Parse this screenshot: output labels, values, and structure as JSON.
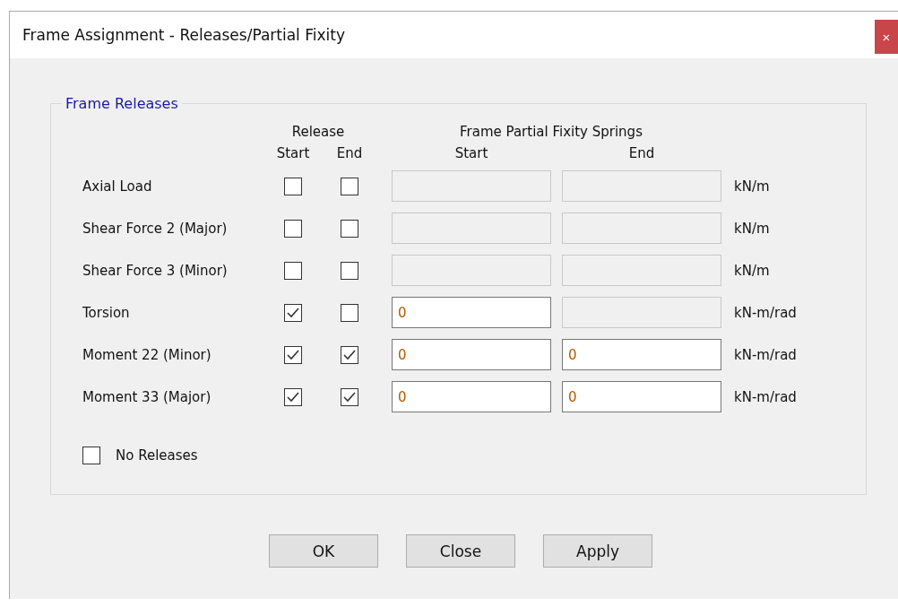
{
  "window": {
    "title": "Frame Assignment - Releases/Partial Fixity",
    "close": "×"
  },
  "group": {
    "title": "Frame Releases",
    "headers": {
      "release": "Release",
      "springs": "Frame Partial Fixity Springs",
      "release_start": "Start",
      "release_end": "End",
      "springs_start": "Start",
      "springs_end": "End"
    },
    "rows": [
      {
        "label": "Axial Load",
        "start_checked": false,
        "end_checked": false,
        "start_field": {
          "disabled": true
        },
        "end_field": {
          "disabled": true
        },
        "unit": "kN/m"
      },
      {
        "label": "Shear Force 2 (Major)",
        "start_checked": false,
        "end_checked": false,
        "start_field": {
          "disabled": true
        },
        "end_field": {
          "disabled": true
        },
        "unit": "kN/m"
      },
      {
        "label": "Shear Force 3 (Minor)",
        "start_checked": false,
        "end_checked": false,
        "start_field": {
          "disabled": true
        },
        "end_field": {
          "disabled": true
        },
        "unit": "kN/m"
      },
      {
        "label": "Torsion",
        "start_checked": true,
        "end_checked": false,
        "start_field": {
          "disabled": false,
          "value": "0"
        },
        "end_field": {
          "disabled": true
        },
        "unit": "kN-m/rad"
      },
      {
        "label": "Moment 22 (Minor)",
        "start_checked": true,
        "end_checked": true,
        "start_field": {
          "disabled": false,
          "value": "0"
        },
        "end_field": {
          "disabled": false,
          "value": "0"
        },
        "unit": "kN-m/rad"
      },
      {
        "label": "Moment 33 (Major)",
        "start_checked": true,
        "end_checked": true,
        "start_field": {
          "disabled": false,
          "value": "0"
        },
        "end_field": {
          "disabled": false,
          "value": "0"
        },
        "unit": "kN-m/rad"
      }
    ],
    "no_releases": {
      "label": "No Releases",
      "checked": false
    }
  },
  "buttons": [
    "OK",
    "Close",
    "Apply"
  ]
}
